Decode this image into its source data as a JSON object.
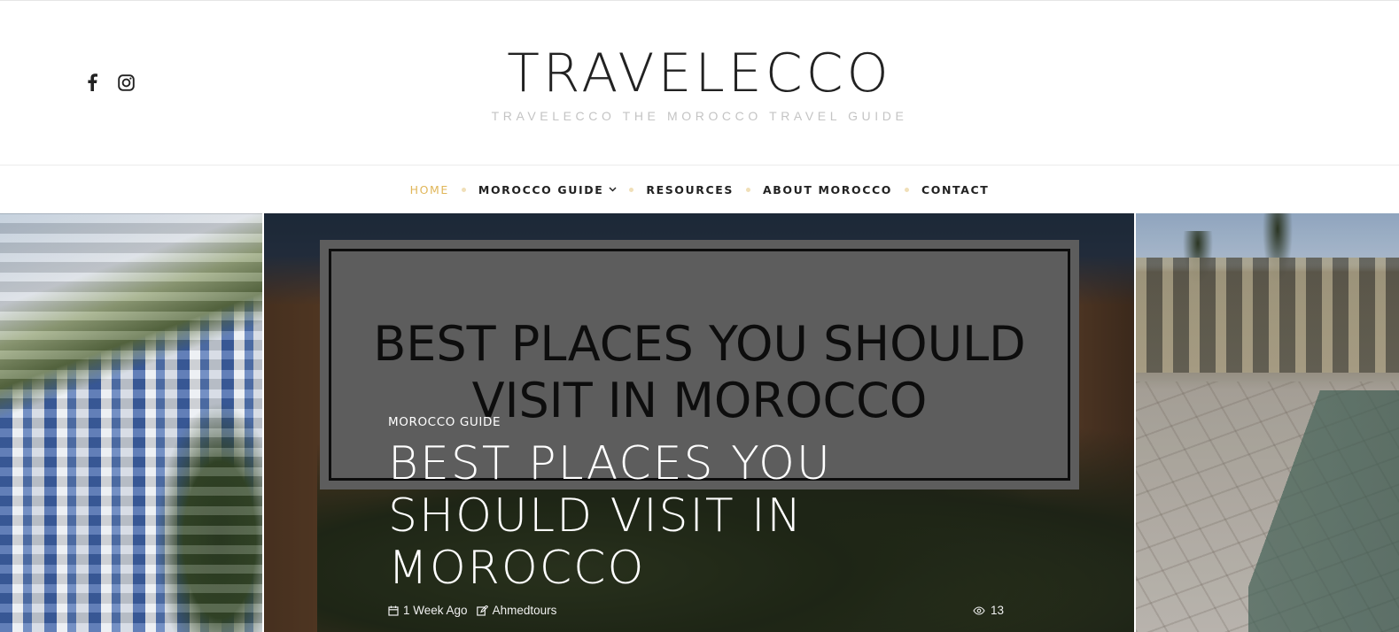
{
  "header": {
    "site_title": "TRAVELECCO",
    "tagline": "TRAVELECCO THE MOROCCO TRAVEL GUIDE",
    "social": [
      {
        "icon": "facebook-icon"
      },
      {
        "icon": "instagram-icon"
      }
    ]
  },
  "nav": {
    "items": [
      {
        "label": "HOME",
        "active": true
      },
      {
        "label": "MOROCCO GUIDE",
        "has_dropdown": true
      },
      {
        "label": "RESOURCES"
      },
      {
        "label": "ABOUT MOROCCO"
      },
      {
        "label": "CONTACT"
      }
    ],
    "active_color": "#e0b659"
  },
  "slider": {
    "featured": {
      "image_sign_text": "BEST PLACES YOU SHOULD VISIT IN MOROCCO",
      "category": "MOROCCO GUIDE",
      "title": "BEST PLACES YOU SHOULD VISIT IN MOROCCO",
      "date": "1 Week Ago",
      "author": "Ahmedtours",
      "views": "13"
    }
  }
}
